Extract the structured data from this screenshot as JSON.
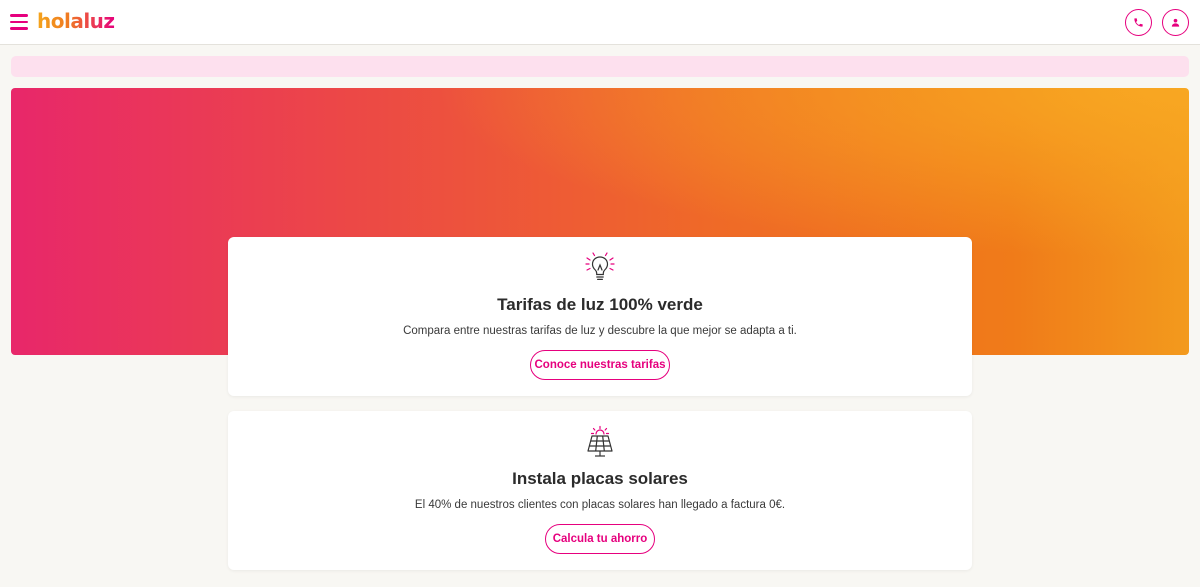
{
  "header": {
    "logo_text": "holaluz",
    "menu_icon": "hamburger-icon",
    "phone_icon": "phone-icon",
    "user_icon": "user-icon",
    "brand_color": "#e6007e"
  },
  "cards": [
    {
      "icon": "lightbulb-icon",
      "title": "Tarifas de luz 100% verde",
      "text": "Compara entre nuestras tarifas de luz y descubre la que mejor se adapta a ti.",
      "button_label": "Conoce nuestras tarifas"
    },
    {
      "icon": "solar-panel-icon",
      "title": "Instala placas solares",
      "text": "El 40% de nuestros clientes con placas solares han llegado a factura 0€.",
      "button_label": "Calcula tu ahorro"
    }
  ]
}
